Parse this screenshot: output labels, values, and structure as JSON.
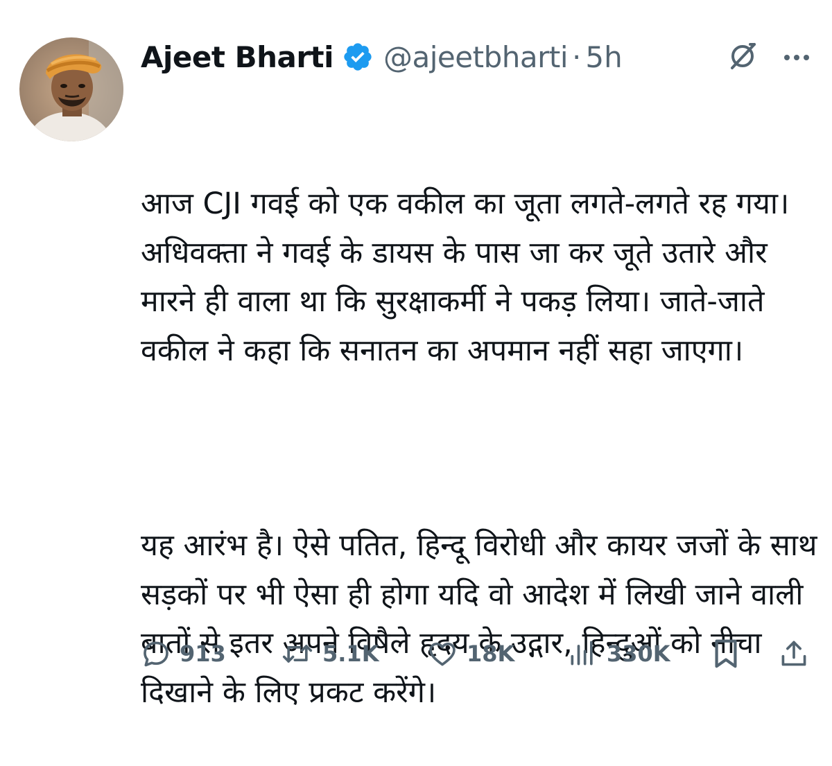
{
  "tweet": {
    "author_name": "Ajeet Bharti",
    "handle": "@ajeetbharti",
    "separator": "·",
    "time": "5h",
    "paragraphs": [
      "आज CJI गवई को एक वकील का जूता लगते-लगते रह गया। अधिवक्ता ने गवई के डायस के पास जा कर जूते उतारे और मारने ही वाला था कि सुरक्षाकर्मी ने पकड़ लिया। जाते-जाते वकील ने कहा कि सनातन का अपमान नहीं सहा जाएगा।",
      "यह आरंभ है। ऐसे पतित, हिन्दू विरोधी और कायर जजों के साथ सड़कों पर भी ऐसा ही होगा यदि वो आदेश में लिखी जाने वाली बातों से इतर अपने विषैले हृदय के उद्गार, हिन्दुओं को नीचा दिखाने के लिए प्रकट करेंगे।"
    ]
  },
  "actions": {
    "replies": "913",
    "reposts": "5.1K",
    "likes": "18K",
    "views": "330K"
  },
  "icons": {
    "verified": "verified-badge-icon",
    "grok": "grok-icon",
    "more": "more-options-icon",
    "reply": "reply-icon",
    "repost": "repost-icon",
    "like": "like-icon",
    "views": "views-icon",
    "bookmark": "bookmark-icon",
    "share": "share-icon"
  },
  "colors": {
    "text": "#0f1419",
    "secondary": "#536471",
    "verified": "#1d9bf0"
  }
}
